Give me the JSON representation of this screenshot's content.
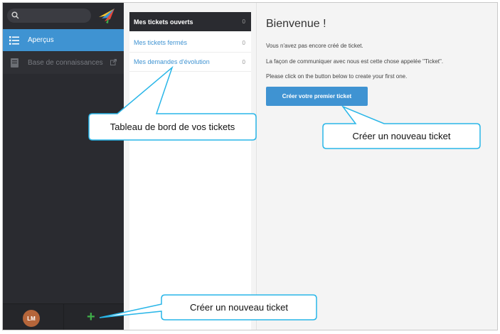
{
  "sidebar": {
    "search_icon": "search-icon",
    "logo": "bird-logo",
    "items": [
      {
        "label": "Aperçus",
        "icon": "list-icon"
      },
      {
        "label": "Base de connaissances",
        "icon": "book-icon",
        "trailing_icon": "external-link-icon"
      }
    ],
    "footer": {
      "avatar_initials": "LM",
      "add_symbol": "+"
    }
  },
  "ticket_list": {
    "items": [
      {
        "label": "Mes tickets ouverts",
        "count": "0"
      },
      {
        "label": "Mes tickets fermés",
        "count": "0"
      },
      {
        "label": "Mes demandes d'évolution",
        "count": "0"
      }
    ]
  },
  "main": {
    "title": "Bienvenue !",
    "paragraphs": [
      "Vous n'avez pas encore créé de ticket.",
      "La façon de communiquer avec nous est cette chose appelée \"Ticket\".",
      "Please click on the button below to create your first one."
    ],
    "create_button": "Créer votre premier ticket"
  },
  "callouts": [
    {
      "text": "Tableau de bord de vos tickets"
    },
    {
      "text": "Créer un nouveau ticket"
    },
    {
      "text": "Créer un nouveau ticket"
    }
  ],
  "colors": {
    "accent": "#3f93d2",
    "sidebar": "#2a2b30",
    "add": "#3fae49",
    "callout_border": "#29b6e8"
  }
}
